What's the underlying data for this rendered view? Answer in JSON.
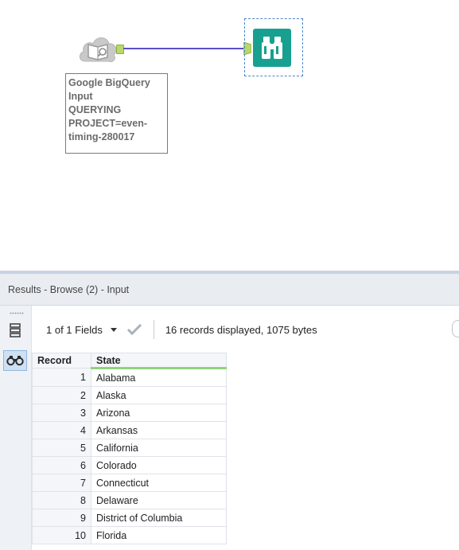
{
  "canvas": {
    "input_tool": {
      "annotation": "Google BigQuery Input\nQUERYING PROJECT=even-timing-280017",
      "icon": "book-magnifier-icon"
    },
    "browse_tool": {
      "icon": "binoculars-icon",
      "color": "#17a08f"
    },
    "connection_color": "#5a50c8"
  },
  "results": {
    "title": "Results - Browse (2) - Input",
    "toolbar": {
      "fields_label": "1 of 1 Fields",
      "record_info": "16 records displayed, 1075 bytes"
    },
    "grid": {
      "headers": [
        "Record",
        "State"
      ],
      "rows": [
        [
          "1",
          "Alabama"
        ],
        [
          "2",
          "Alaska"
        ],
        [
          "3",
          "Arizona"
        ],
        [
          "4",
          "Arkansas"
        ],
        [
          "5",
          "California"
        ],
        [
          "6",
          "Colorado"
        ],
        [
          "7",
          "Connecticut"
        ],
        [
          "8",
          "Delaware"
        ],
        [
          "9",
          "District of Columbia"
        ],
        [
          "10",
          "Florida"
        ]
      ]
    }
  }
}
